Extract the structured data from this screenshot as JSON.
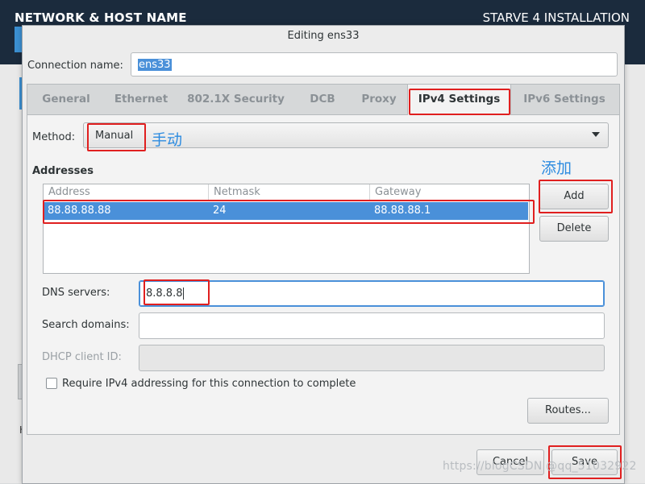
{
  "installer": {
    "section_title": "NETWORK & HOST NAME",
    "product_title": "STARVE 4 INSTALLATION",
    "bg_fragment": "H"
  },
  "dialog": {
    "title": "Editing ens33",
    "connection_name_label": "Connection name:",
    "connection_name_value": "ens33",
    "tabs": [
      {
        "label": "General"
      },
      {
        "label": "Ethernet"
      },
      {
        "label": "802.1X Security"
      },
      {
        "label": "DCB"
      },
      {
        "label": "Proxy"
      },
      {
        "label": "IPv4 Settings",
        "active": true
      },
      {
        "label": "IPv6 Settings"
      }
    ],
    "method_label": "Method:",
    "method_value": "Manual",
    "addresses_label": "Addresses",
    "addresses": {
      "columns": [
        "Address",
        "Netmask",
        "Gateway"
      ],
      "rows": [
        {
          "address": "88.88.88.88",
          "netmask": "24",
          "gateway": "88.88.88.1"
        }
      ]
    },
    "add_button": "Add",
    "delete_button": "Delete",
    "dns_label": "DNS servers:",
    "dns_value": "8.8.8.8",
    "search_domains_label": "Search domains:",
    "search_domains_value": "",
    "dhcp_client_id_label": "DHCP client ID:",
    "dhcp_client_id_value": "",
    "require_ipv4_label": "Require IPv4 addressing for this connection to complete",
    "require_ipv4_checked": false,
    "routes_button": "Routes...",
    "cancel_button": "Cancel",
    "save_button": "Save"
  },
  "annotations": {
    "note_manual": "手动",
    "note_add": "添加",
    "color": "#e01f1f",
    "note_color": "#2c8be0"
  },
  "watermark": "https://blogCSDN @qq_51032922"
}
